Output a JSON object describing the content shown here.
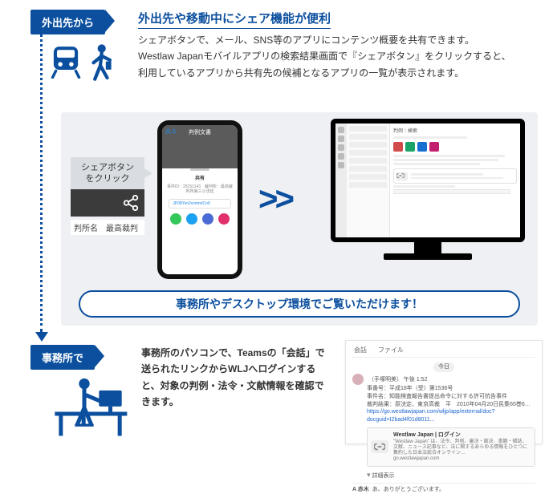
{
  "badges": {
    "out": "外出先から",
    "office": "事務所で"
  },
  "heading": "外出先や移動中にシェア機能が便利",
  "description": "シェアボタンで、メール、SNS等のアプリにコンテンツ概要を共有できます。\nWestlaw Japanモバイルアプリの検索結果画面で『シェアボタン』をクリックすると、\n利用しているアプリから共有先の候補となるアプリの一覧が表示されます。",
  "share_callout": {
    "line1": "シェアボタン",
    "line2": "をクリック"
  },
  "court_strip": "判所名　最高裁判",
  "phone": {
    "back": "戻る",
    "header_title": "判例文書",
    "sheet_title": "共有",
    "sheet_sub": "事件ID：28151143　裁判所：最高裁判所第三小法廷",
    "link_text": "JP08Yvn2vcmm/Cn9"
  },
  "arrow": ">>",
  "monitor": {
    "thread_title": "判例｜検索",
    "chips": [
      {
        "color": "#d14b4b"
      },
      {
        "color": "#1aa366"
      },
      {
        "color": "#156fd1"
      },
      {
        "color": "#c21f6e"
      }
    ]
  },
  "blue_bar": "事務所やデスクトップ環境でご覧いただけます！",
  "description2": "事務所のパソコンで、Teamsの「会話」で送られたリンクからWLJへログインすると、対象の判例・法令・文献情報を確認できます。",
  "chat": {
    "tabs": [
      "会話",
      "ファイル"
    ],
    "timestamp_label": "今日",
    "line1_name": "（手塚明美） 午後 1:52",
    "line2": "事番号：平成18年（受）第1536号",
    "line3": "事件名：知能検査報告書提出命令に対する許可抗告事件",
    "line4": "裁判結果：原決定、東京高裁　平　2010年04月20日民集65巻6…",
    "url": "https://go.westlawjapan.com/wljp/app/external/doc?docguid=I2bad4f01d8011...",
    "ogp_title": "Westlaw Japan | ログイン",
    "ogp_sub": "\"Westlaw Japan\" は、法令、判例、審決・裁決、書籍・雑誌、文献、ニュース記事など、法に関するあらゆる情報をひとつに集約した日本法総合オンライン…",
    "ogp_domain": "go.westlawjapan.com",
    "expand": "詳細表示",
    "reply_name": "A 赤木",
    "reply_text": "あ、ありがとうございます。"
  }
}
